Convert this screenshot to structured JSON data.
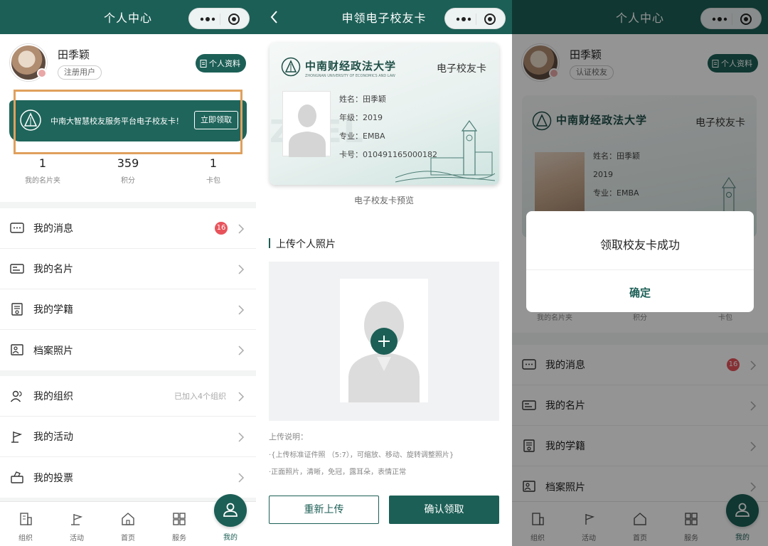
{
  "colors": {
    "primary": "#1c5f56",
    "badge": "#e8535b",
    "highlight_frame": "#e0a05c"
  },
  "panel1": {
    "title": "个人中心",
    "user": {
      "name": "田季颖",
      "tag": "注册用户"
    },
    "profile_button": "个人资料",
    "banner": {
      "text": "中南大智慧校友服务平台电子校友卡！",
      "button": "立即领取"
    },
    "stats": [
      {
        "value": "1",
        "label": "我的名片夹"
      },
      {
        "value": "359",
        "label": "积分"
      },
      {
        "value": "1",
        "label": "卡包"
      }
    ],
    "menu1": [
      {
        "label": "我的消息",
        "icon": "message-icon",
        "badge": "16"
      },
      {
        "label": "我的名片",
        "icon": "card-icon"
      },
      {
        "label": "我的学籍",
        "icon": "certificate-icon"
      },
      {
        "label": "档案照片",
        "icon": "photo-icon"
      }
    ],
    "menu2": [
      {
        "label": "我的组织",
        "icon": "group-icon",
        "extra": "已加入4个组织"
      },
      {
        "label": "我的活动",
        "icon": "flag-icon"
      },
      {
        "label": "我的投票",
        "icon": "vote-icon"
      }
    ]
  },
  "tabs": [
    {
      "label": "组织",
      "icon": "org-icon"
    },
    {
      "label": "活动",
      "icon": "activity-icon"
    },
    {
      "label": "首页",
      "icon": "home-icon"
    },
    {
      "label": "服务",
      "icon": "grid-icon"
    },
    {
      "label": "我的",
      "icon": "user-icon"
    }
  ],
  "panel2": {
    "title": "申领电子校友卡",
    "card": {
      "school": "中南财经政法大学",
      "school_en": "ZHONGNAN UNIVERSITY OF ECONOMICS AND LAW",
      "title": "电子校友卡",
      "name": "姓名：田季颖",
      "grade": "年级：2019",
      "major": "专业：EMBA",
      "number": "卡号：010491165000182",
      "bg_text": "ZUEL"
    },
    "caption": "电子校友卡预览",
    "upload_title": "上传个人照片",
    "notes_title": "上传说明：",
    "notes": [
      "·{上传标准证件照 （5:7），可缩放、移动、旋转调整照片}",
      "·正面照片，清晰，免冠，露耳朵，表情正常"
    ],
    "reupload": "重新上传",
    "confirm": "确认领取"
  },
  "panel3": {
    "title": "个人中心",
    "user": {
      "name": "田季颖",
      "tag": "认证校友"
    },
    "profile_button": "个人资料",
    "card": {
      "school": "中南财经政法大学",
      "title": "电子校友卡",
      "name": "姓名：田季颖",
      "grade": "2019",
      "major": "专业：EMBA"
    },
    "stats_labels": [
      "我的名片夹",
      "积分",
      "卡包"
    ],
    "menu": [
      {
        "label": "我的消息",
        "icon": "message-icon",
        "badge": "16"
      },
      {
        "label": "我的名片",
        "icon": "card-icon"
      },
      {
        "label": "我的学籍",
        "icon": "certificate-icon"
      },
      {
        "label": "档案照片",
        "icon": "photo-icon"
      }
    ],
    "dialog": {
      "message": "领取校友卡成功",
      "button": "确定"
    }
  }
}
